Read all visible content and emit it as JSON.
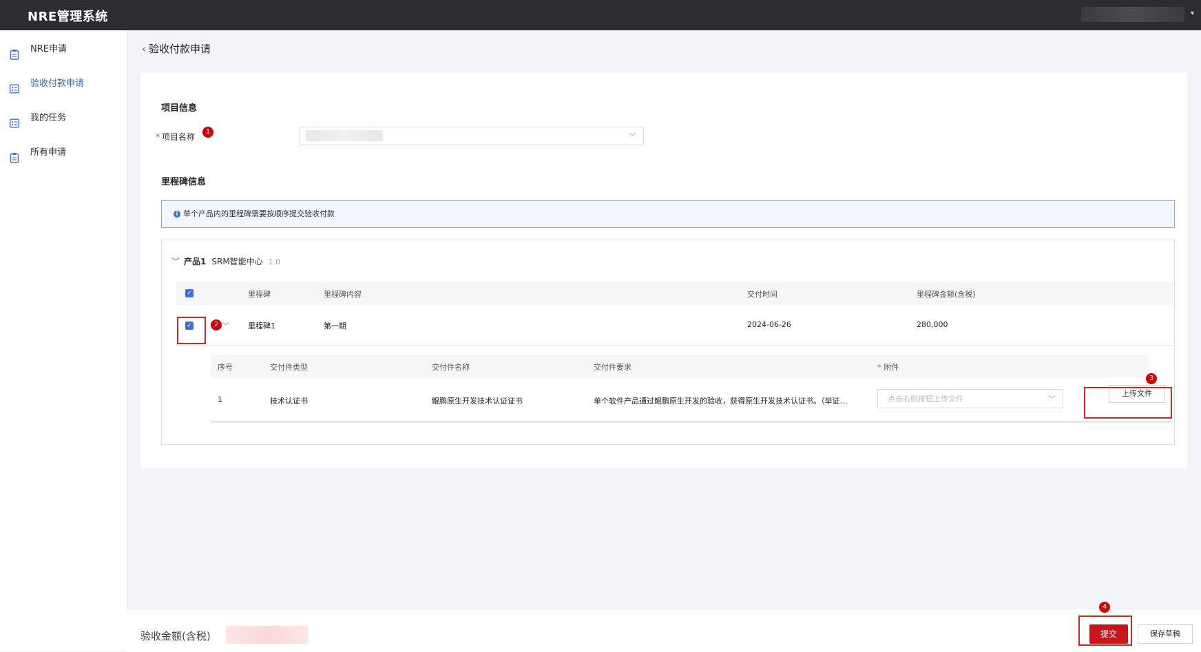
{
  "header": {
    "app_title": "NRE管理系统"
  },
  "sidebar": {
    "items": [
      {
        "label": "NRE申请",
        "icon": "clipboard-icon",
        "active": false
      },
      {
        "label": "验收付款申请",
        "icon": "list-card-icon",
        "active": true
      },
      {
        "label": "我的任务",
        "icon": "list-card-icon",
        "active": false
      },
      {
        "label": "所有申请",
        "icon": "clipboard-icon",
        "active": false
      }
    ]
  },
  "page": {
    "breadcrumb": "验收付款申请"
  },
  "project": {
    "section_title": "项目信息",
    "name_label": "项目名称",
    "required_mark": "*"
  },
  "milestone": {
    "section_title": "里程碑信息",
    "notice": "单个产品内的里程碑需要按顺序提交验收付款",
    "product": {
      "name": "产品1",
      "center": "SRM智能中心",
      "version": "1.0"
    },
    "columns": [
      "里程碑",
      "里程碑内容",
      "交付时间",
      "里程碑金额(含税)"
    ],
    "rows": [
      {
        "milestone": "里程碑1",
        "content": "第一期",
        "delivery_date": "2024-06-26",
        "amount": "280,000"
      }
    ],
    "deliverables": {
      "columns": [
        "序号",
        "交付件类型",
        "交付件名称",
        "交付件要求",
        "附件"
      ],
      "attachment_required_mark": "*",
      "rows": [
        {
          "index": "1",
          "type": "技术认证书",
          "name": "鲲鹏原生开发技术认证证书",
          "requirement": "单个软件产品通过鲲鹏原生开发的验收，获得原生开发技术认证书。（举证…",
          "attachment_placeholder": "点击右侧按钮上传文件"
        }
      ],
      "upload_label": "上传文件"
    }
  },
  "footer": {
    "amount_label": "验收金额(含税)",
    "submit_label": "提交",
    "draft_label": "保存草稿"
  },
  "annotations": [
    "1",
    "2",
    "3",
    "4"
  ],
  "colors": {
    "primary": "#3d6fd8",
    "danger": "#c8161d",
    "header_bg": "#2b2d33",
    "annotation": "#e02020"
  }
}
